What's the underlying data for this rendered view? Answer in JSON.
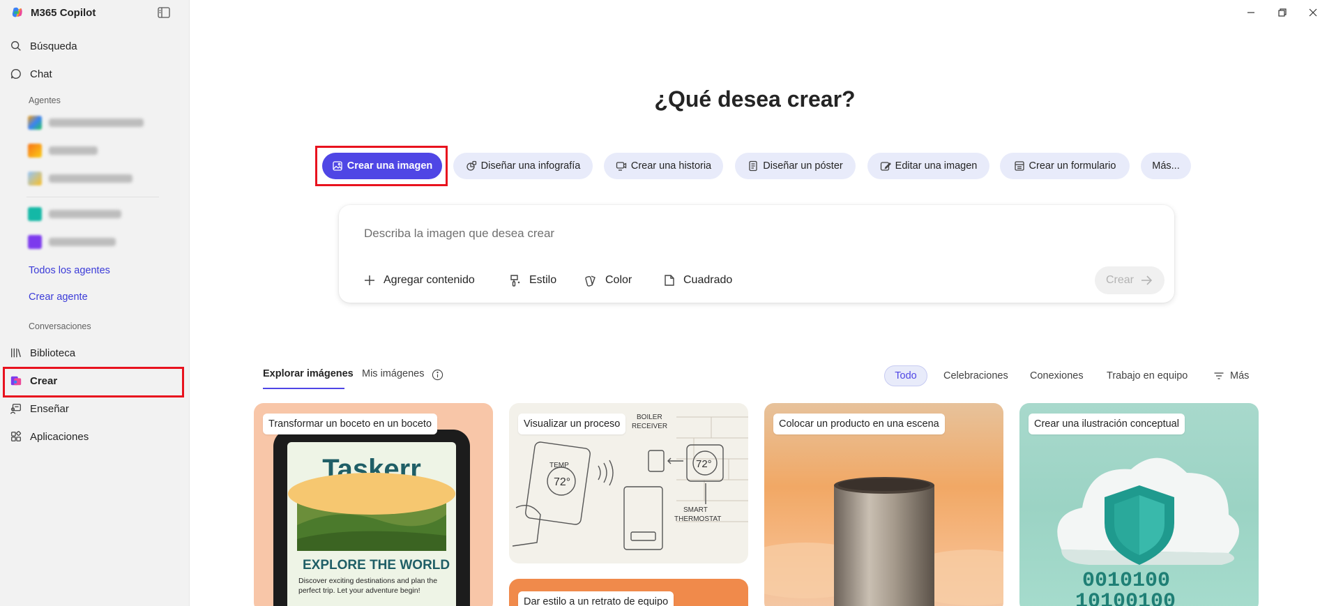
{
  "app": {
    "title": "M365 Copilot"
  },
  "sidebar": {
    "nav_top": [
      {
        "label": "Búsqueda",
        "icon": "search-icon"
      },
      {
        "label": "Chat",
        "icon": "chat-icon"
      }
    ],
    "agents_heading": "Agentes",
    "all_agents_link": "Todos los agentes",
    "create_agent_link": "Crear agente",
    "conversations_heading": "Conversaciones",
    "nav_bottom": [
      {
        "label": "Biblioteca",
        "icon": "library-icon"
      },
      {
        "label": "Crear",
        "icon": "create-icon"
      },
      {
        "label": "Enseñar",
        "icon": "teach-icon"
      },
      {
        "label": "Aplicaciones",
        "icon": "apps-icon"
      }
    ]
  },
  "main": {
    "title": "¿Qué desea crear?",
    "chips": [
      {
        "label": "Crear una imagen",
        "icon": "image-icon"
      },
      {
        "label": "Diseñar una infografía",
        "icon": "infographic-icon"
      },
      {
        "label": "Crear una historia",
        "icon": "story-icon"
      },
      {
        "label": "Diseñar un póster",
        "icon": "poster-icon"
      },
      {
        "label": "Editar una imagen",
        "icon": "edit-image-icon"
      },
      {
        "label": "Crear un formulario",
        "icon": "form-icon"
      },
      {
        "label": "Más...",
        "icon": ""
      }
    ],
    "prompt": {
      "placeholder": "Describa la imagen que desea crear",
      "value": "",
      "options": [
        {
          "label": "Agregar contenido",
          "icon": "plus-icon"
        },
        {
          "label": "Estilo",
          "icon": "style-icon"
        },
        {
          "label": "Color",
          "icon": "color-icon"
        },
        {
          "label": "Cuadrado",
          "icon": "square-icon"
        }
      ],
      "create_label": "Crear"
    },
    "tabs": [
      "Explorar imágenes",
      "Mis imágenes"
    ],
    "filters": [
      "Todo",
      "Celebraciones",
      "Conexiones",
      "Trabajo en equipo",
      "Más"
    ],
    "cards": [
      "Transformar un boceto en un boceto",
      "Visualizar un proceso",
      "Colocar un producto en una escena",
      "Crear una ilustración conceptual",
      "Dar estilo a un retrato de equipo"
    ],
    "card_images": {
      "taskerr_title": "Taskerr",
      "taskerr_headline": "EXPLORE THE WORLD",
      "taskerr_body_1": "Discover exciting destinations and plan the",
      "taskerr_body_2": "perfect trip. Let your adventure begin!",
      "process_temp": "TEMP",
      "process_temp_value": "72°",
      "process_boiler_1": "BOILER",
      "process_boiler_2": "RECEIVER",
      "process_thermo_value": "72°",
      "process_smart_1": "SMART",
      "process_smart_2": "THERMOSTAT",
      "concept_binary_1": "0010100",
      "concept_binary_2": "10100100"
    }
  },
  "colors": {
    "accent": "#4f46e5",
    "chip_bg": "#e8ebfa",
    "link": "#3b3bd8",
    "highlight": "#e8121e"
  }
}
